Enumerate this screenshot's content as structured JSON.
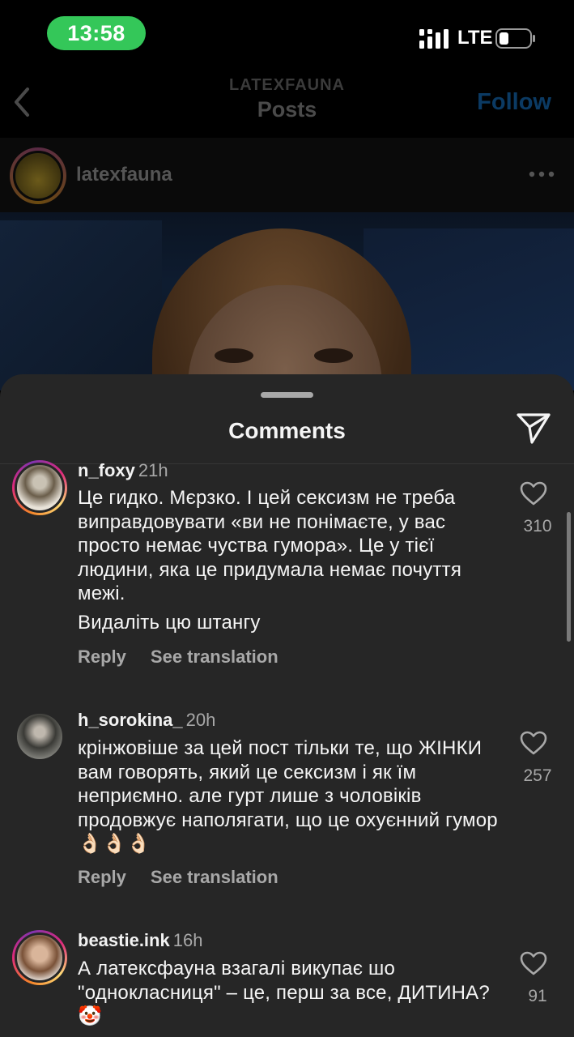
{
  "status": {
    "time": "13:58",
    "network": "LTE"
  },
  "nav": {
    "subtitle": "LATEXFAUNA",
    "title": "Posts",
    "follow": "Follow"
  },
  "post": {
    "username": "latexfauna"
  },
  "sheet": {
    "title": "Comments"
  },
  "comments": [
    {
      "username": "n_foxy",
      "time": "21h",
      "paragraphs": [
        "Це гидко. Мєрзко. І цей сексизм не треба виправдовувати «ви не понімаєте, у вас просто немає чуства гумора». Це у тієї людини, яка це придумала немає почуття межі.",
        "Видаліть цю штангу"
      ],
      "reply": "Reply",
      "translate": "See translation",
      "likes": "310"
    },
    {
      "username": "h_sorokina_",
      "time": "20h",
      "text": "крінжовіше за цей пост тільки те, що ЖІНКИ вам говорять, який це сексизм і як їм неприємно. але гурт лише з чоловіків продовжує наполягати, що це охуєнний гумор",
      "emoji": "👌🏻👌🏻👌🏻",
      "reply": "Reply",
      "translate": "See translation",
      "likes": "257"
    },
    {
      "username": "beastie.ink",
      "time": "16h",
      "text": "А латексфауна взагалі викупає шо \"однокласниця\" – це, перш за все, ДИТИНА?",
      "emoji": "🤡",
      "likes": "91"
    }
  ]
}
